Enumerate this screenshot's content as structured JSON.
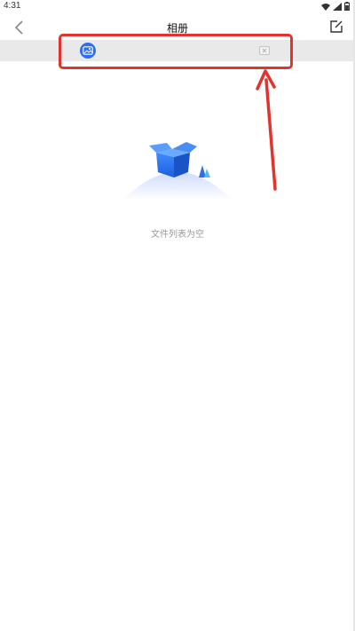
{
  "status_bar": {
    "time": "4:31"
  },
  "app_bar": {
    "title": "相册"
  },
  "album_row": {
    "icon": "image-icon",
    "close_icon": "close-icon"
  },
  "empty_state": {
    "message": "文件列表为空"
  },
  "colors": {
    "accent": "#2f6ef0",
    "highlight": "#e2342c",
    "row_bg": "#e9e9e9"
  }
}
